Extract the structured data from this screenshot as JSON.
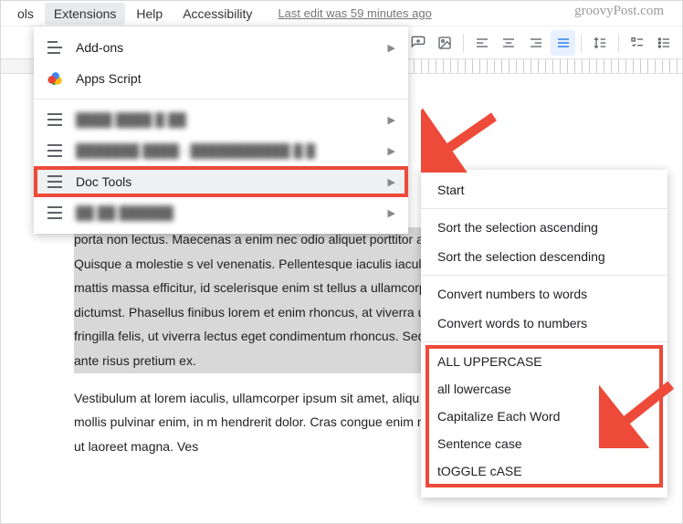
{
  "watermark": "groovyPost.com",
  "menubar": {
    "tools": "ols",
    "extensions": "Extensions",
    "help": "Help",
    "accessibility": "Accessibility",
    "last_edit": "Last edit was 59 minutes ago"
  },
  "ext_menu": {
    "addons": "Add-ons",
    "apps_script": "Apps Script",
    "blurred1": "████ ████ █ ██",
    "blurred2": "███████ ████ - ███████████ █ █",
    "doc_tools": "Doc Tools",
    "blurred3": "██ ██ ██████"
  },
  "submenu": {
    "start": "Start",
    "sort_asc": "Sort the selection ascending",
    "sort_desc": "Sort the selection descending",
    "num_to_words": "Convert numbers to words",
    "words_to_num": "Convert words to numbers",
    "case": {
      "upper": "ALL UPPERCASE",
      "lower": "all lowercase",
      "cap_each": "Capitalize Each Word",
      "sentence": "Sentence case",
      "toggle": "tOGGLE cASE"
    }
  },
  "doc": {
    "p1": "porta non lectus. Maecenas a enim nec odio aliquet porttitor aliquet vitae cursus id, blandit quis ante. Quisque a molestie s vel venenatis. Pellentesque iaculis iaculis felis, eu condimen accumsan ante mattis massa efficitur, id scelerisque enim st tellus a ullamcorper. Etiam vel consequat elit, id porttitor c dictumst. Phasellus finibus lorem et enim rhoncus, at viverra urna vitae dignissim ornare, est nibh fringilla felis, ut viverra lectus eget condimentum rhoncus. Sed cursus, dui eu ultricie enim, quis tempor ante risus pretium ex.",
    "p2": "Vestibulum at lorem iaculis, ullamcorper ipsum sit amet, aliqu vitae ultrices leo semper in. Quisque mollis pulvinar enim, in m hendrerit dolor. Cras congue enim nibh nec viverra vulputat ultrices. Vivamus ut laoreet magna. Ves"
  }
}
